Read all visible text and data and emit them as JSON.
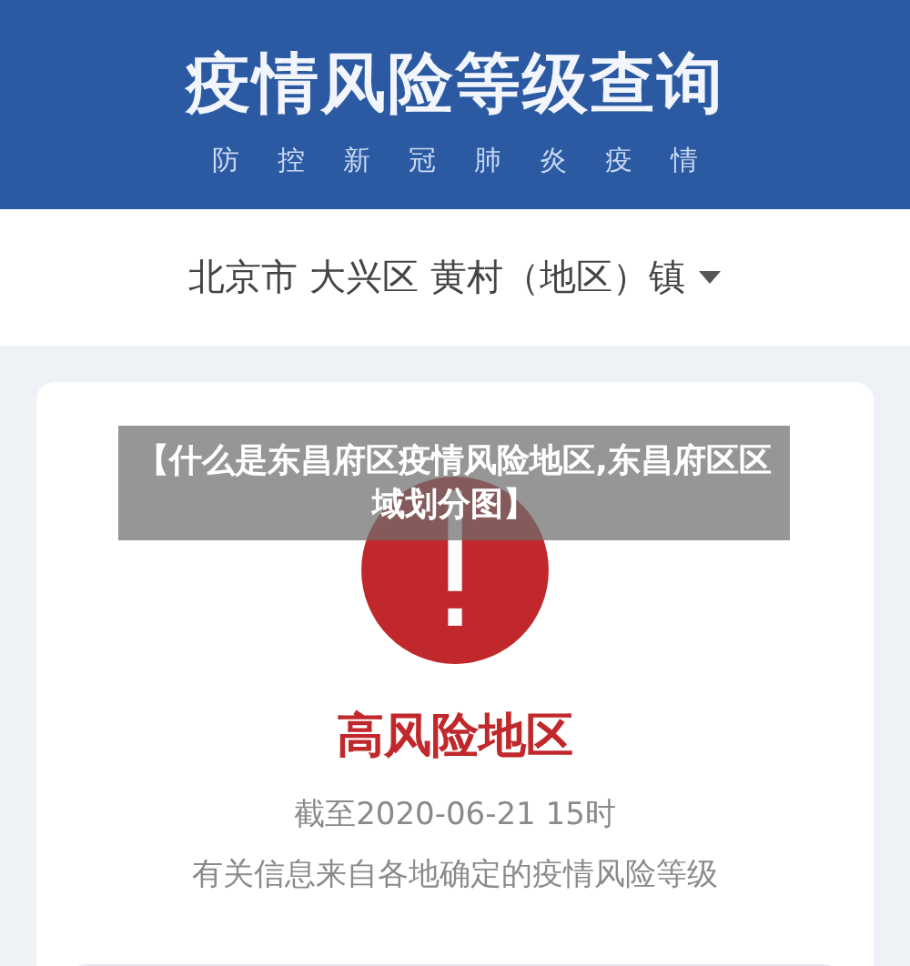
{
  "header": {
    "title": "疫情风险等级查询",
    "subtitle": [
      "防",
      "控",
      "新",
      "冠",
      "肺",
      "炎",
      "疫",
      "情"
    ]
  },
  "location": {
    "text": "北京市 大兴区 黄村（地区）镇"
  },
  "result": {
    "kind": "high",
    "label": "高风险地区",
    "updated": "截至2020-06-21 15时",
    "note": "有关信息来自各地确定的疫情风险等级"
  },
  "caption": "【什么是东昌府区疫情风险地区,东昌府区区域划分图】"
}
